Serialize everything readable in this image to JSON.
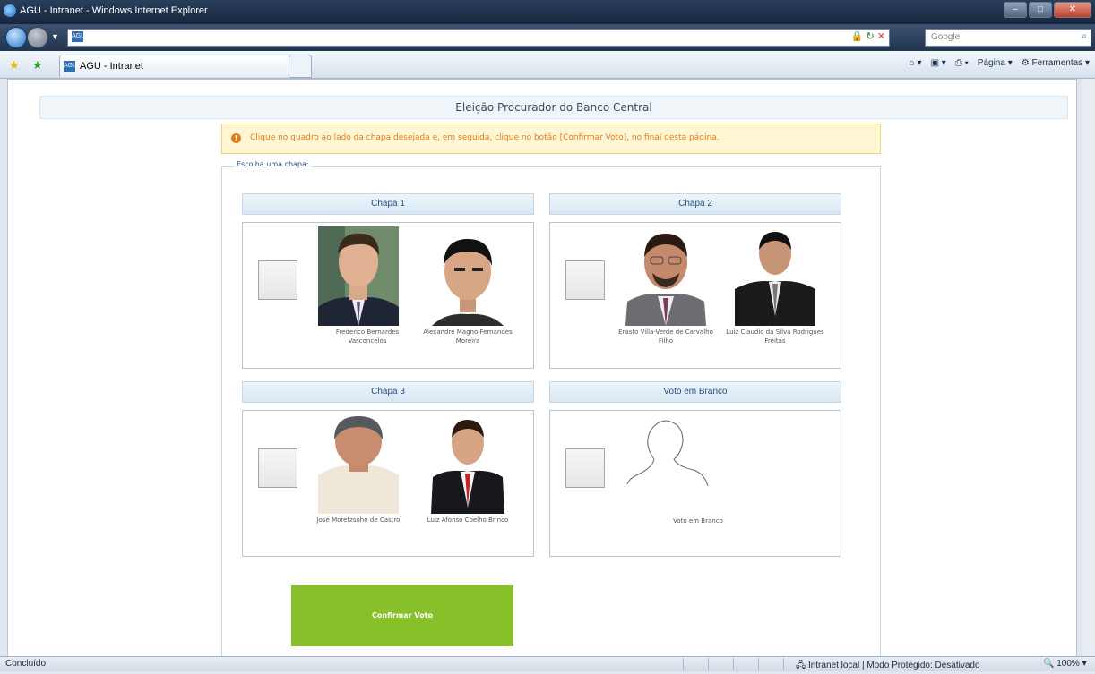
{
  "window": {
    "title": "AGU - Intranet - Windows Internet Explorer"
  },
  "address": {
    "search_placeholder": "Google"
  },
  "tab": {
    "title": "AGU - Intranet"
  },
  "commandbar": {
    "page_label": "Página",
    "tools_label": "Ferramentas"
  },
  "page": {
    "heading": "Eleição Procurador do Banco Central",
    "alert": "Clique no quadro ao lado da chapa desejada e, em seguida, clique no botão [Confirmar Voto], no final desta página.",
    "fieldset_legend": "Escolha uma chapa:",
    "slates": [
      {
        "title": "Chapa 1",
        "candidates": [
          {
            "name": "Frederico Bernardes Vasconcelos"
          },
          {
            "name": "Alexandre Magno Fernandes Moreira"
          }
        ]
      },
      {
        "title": "Chapa 2",
        "candidates": [
          {
            "name": "Erasto Villa-Verde de Carvalho Filho"
          },
          {
            "name": "Luiz Claudio da Silva Rodrigues Freitas"
          }
        ]
      },
      {
        "title": "Chapa 3",
        "candidates": [
          {
            "name": "José Moretzsohn de Castro"
          },
          {
            "name": "Luiz Afonso Coelho Brinco"
          }
        ]
      },
      {
        "title": "Voto em Branco",
        "blank_label": "Voto em Branco"
      }
    ],
    "confirm_button": "Confirmar Voto"
  },
  "status": {
    "text": "Concluído",
    "zone": "Intranet local | Modo Protegido: Desativado",
    "zoom": "100%"
  },
  "colors": {
    "confirm": "#88c02a",
    "alert_text": "#e07b1c",
    "slate_header_text": "#1f4f86"
  }
}
